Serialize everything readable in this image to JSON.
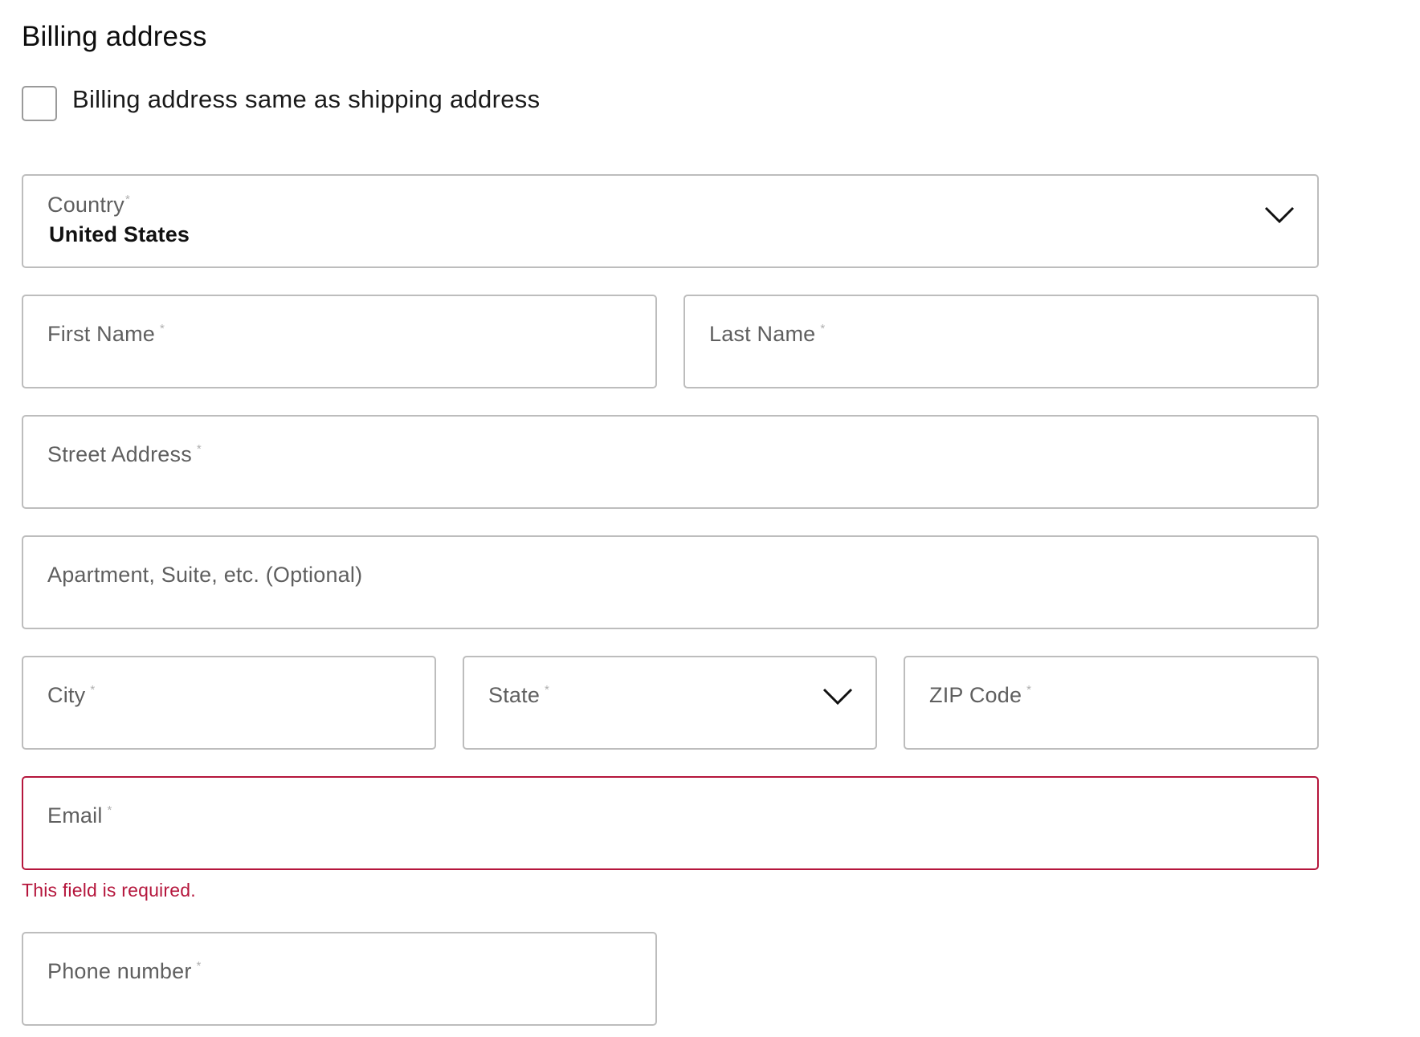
{
  "section": {
    "title": "Billing address"
  },
  "same_as_shipping": {
    "label": "Billing address same as shipping address",
    "checked": false
  },
  "fields": {
    "country": {
      "label": "Country",
      "required_mark": "*",
      "value": "United States"
    },
    "first_name": {
      "label": "First Name",
      "required_mark": "*"
    },
    "last_name": {
      "label": "Last Name",
      "required_mark": "*"
    },
    "street": {
      "label": "Street Address",
      "required_mark": "*"
    },
    "apartment": {
      "label": "Apartment, Suite, etc. (Optional)"
    },
    "city": {
      "label": "City",
      "required_mark": "*"
    },
    "state": {
      "label": "State",
      "required_mark": "*"
    },
    "zip": {
      "label": "ZIP Code",
      "required_mark": "*"
    },
    "email": {
      "label": "Email",
      "required_mark": "*",
      "error": "This field is required."
    },
    "phone": {
      "label": "Phone number",
      "required_mark": "*"
    }
  },
  "icons": {
    "dropdown": "chevron-down-icon"
  },
  "colors": {
    "border": "#bdbdbd",
    "error": "#b5163c",
    "label": "#5f5f5f"
  }
}
